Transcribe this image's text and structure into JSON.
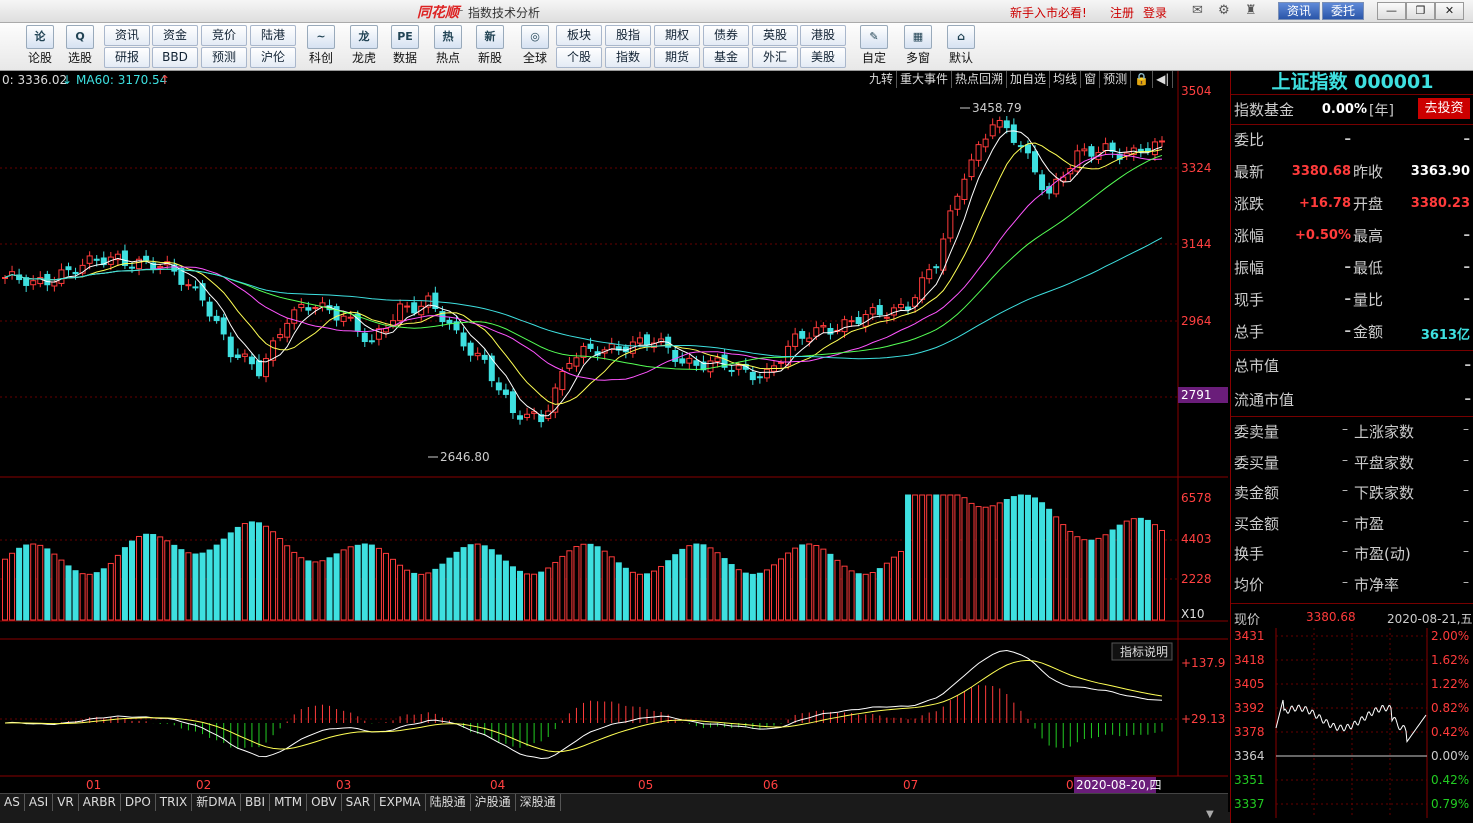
{
  "titlebar": {
    "logo": "同花顺",
    "sep": "-",
    "title": "指数技术分析",
    "newbie": "新手入市必看!",
    "register": "注册",
    "login": "登录",
    "zixun": "资讯",
    "weituo": "委托",
    "minimize": "—",
    "restore": "❐",
    "close": "✕"
  },
  "toolbar": {
    "big": [
      {
        "label": "论股",
        "icon": "论"
      },
      {
        "label": "选股",
        "icon": "Q"
      },
      {
        "label": "科创",
        "icon": "~"
      },
      {
        "label": "龙虎",
        "icon": "龙"
      },
      {
        "label": "数据",
        "icon": "PE"
      },
      {
        "label": "热点",
        "icon": "热"
      },
      {
        "label": "新股",
        "icon": "新"
      },
      {
        "label": "全球",
        "icon": "◎"
      },
      {
        "label": "自定",
        "icon": "✎"
      },
      {
        "label": "多窗",
        "icon": "▦"
      },
      {
        "label": "默认",
        "icon": "⌂"
      }
    ],
    "small_top": [
      "资讯",
      "资金",
      "竞价",
      "陆港",
      "板块",
      "股指",
      "期权",
      "债券",
      "英股",
      "港股"
    ],
    "small_bottom": [
      "研报",
      "BBD",
      "预测",
      "沪伦",
      "个股",
      "指数",
      "期货",
      "基金",
      "外汇",
      "美股"
    ]
  },
  "chart": {
    "ma_label_1": "0: 3336.02",
    "ma_arrow_1": "↓",
    "ma_label_2": "MA60: 3170.54",
    "ma_arrow_2": "↑",
    "top_tabs": [
      "九转",
      "重大事件",
      "热点回溯",
      "加自选",
      "均线",
      "窗",
      "预测",
      "🔒",
      "◀|"
    ],
    "price_axis": [
      "3504",
      "3324",
      "3144",
      "2964",
      "2791"
    ],
    "high_label": "3458.79",
    "low_label": "2646.80",
    "vol_axis": [
      "6578",
      "4403",
      "2228",
      "X10"
    ],
    "macd_axis": [
      "+137.9",
      "+29.13"
    ],
    "indicator_help": "指标说明",
    "months": [
      "01",
      "02",
      "03",
      "04",
      "05",
      "06",
      "07",
      "08"
    ],
    "cursor_date": "2020-08-20,四",
    "bottom_tabs": [
      "AS",
      "ASI",
      "VR",
      "ARBR",
      "DPO",
      "TRIX",
      "新DMA",
      "BBI",
      "MTM",
      "OBV",
      "SAR",
      "EXPMA",
      "陆股通",
      "沪股通",
      "深股通"
    ]
  },
  "chart_data": {
    "type": "candlestick",
    "title": "",
    "xlabel": "",
    "ylabel": "",
    "ylim": [
      2600,
      3520
    ],
    "x_ticks": [
      "01",
      "02",
      "03",
      "04",
      "05",
      "06",
      "07",
      "08"
    ],
    "high": 3458.79,
    "low": 2646.8,
    "ma60_last": 3170.54,
    "volume_axis_ticks": [
      6578,
      4403,
      2228
    ],
    "volume_multiplier": "X10",
    "macd_axis_ticks": [
      137.9,
      29.13
    ],
    "close_path": [
      3060,
      3040,
      3075,
      3090,
      3110,
      3095,
      3070,
      3020,
      2870,
      2840,
      2960,
      2990,
      2975,
      2890,
      2990,
      3000,
      2915,
      2860,
      2720,
      2720,
      2860,
      2880,
      2900,
      2900,
      2860,
      2850,
      2830,
      2830,
      2900,
      2940,
      2950,
      2970,
      3000,
      3090,
      3320,
      3440,
      3380,
      3270,
      3350,
      3380,
      3360,
      3380
    ],
    "intraday": {
      "price": "3380.68",
      "date": "2020-08-21,五",
      "left_axis": [
        "3431",
        "3418",
        "3405",
        "3392",
        "3378",
        "3364",
        "3351",
        "3337"
      ],
      "right_axis": [
        "2.00%",
        "1.62%",
        "1.22%",
        "0.82%",
        "0.42%",
        "0.00%",
        "0.42%",
        "0.79%"
      ]
    }
  },
  "panel": {
    "title": "上证指数 000001",
    "fund_label": "指数基金",
    "fund_value": "0.00%",
    "fund_unit": "[年]",
    "invest_btn": "去投资",
    "rows": [
      {
        "l1": "委比",
        "v1": "–",
        "l2": "",
        "v2": "–"
      },
      {
        "l1": "最新",
        "v1": "3380.68",
        "c1": "#ff3b3b",
        "l2": "昨收",
        "v2": "3363.90",
        "c2": "#ffffff"
      },
      {
        "l1": "涨跌",
        "v1": "+16.78",
        "c1": "#ff3b3b",
        "l2": "开盘",
        "v2": "3380.23",
        "c2": "#ff3b3b"
      },
      {
        "l1": "涨幅",
        "v1": "+0.50%",
        "c1": "#ff3b3b",
        "l2": "最高",
        "v2": "–",
        "c2": "#ccc"
      },
      {
        "l1": "振幅",
        "v1": "–",
        "c1": "#ccc",
        "l2": "最低",
        "v2": "–",
        "c2": "#ccc"
      },
      {
        "l1": "现手",
        "v1": "–",
        "c1": "#ccc",
        "l2": "量比",
        "v2": "–",
        "c2": "#ccc"
      },
      {
        "l1": "总手",
        "v1": "–",
        "c1": "#ccc",
        "l2": "金额",
        "v2": "3613亿",
        "c2": "#3ee0e0"
      }
    ],
    "mkt_cap": "总市值",
    "float_cap": "流通市值",
    "stats_left": [
      "委卖量",
      "委买量",
      "卖金额",
      "买金额",
      "换手",
      "均价"
    ],
    "stats_right": [
      "上涨家数",
      "平盘家数",
      "下跌家数",
      "市盈",
      "市盈(动)",
      "市净率"
    ],
    "current_price_label": "现价"
  }
}
